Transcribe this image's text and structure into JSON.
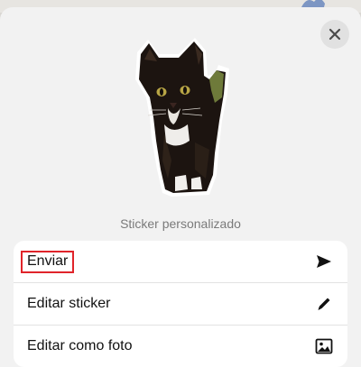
{
  "sheet": {
    "caption": "Sticker personalizado"
  },
  "menu": {
    "items": [
      {
        "label": "Enviar",
        "icon": "send-icon",
        "highlighted": true
      },
      {
        "label": "Editar sticker",
        "icon": "pencil-icon"
      },
      {
        "label": "Editar como foto",
        "icon": "image-icon"
      }
    ]
  },
  "colors": {
    "sheet_bg": "#f2f2f2",
    "menu_bg": "#ffffff",
    "highlight": "#e0242a",
    "caption": "#7a7a7a"
  }
}
